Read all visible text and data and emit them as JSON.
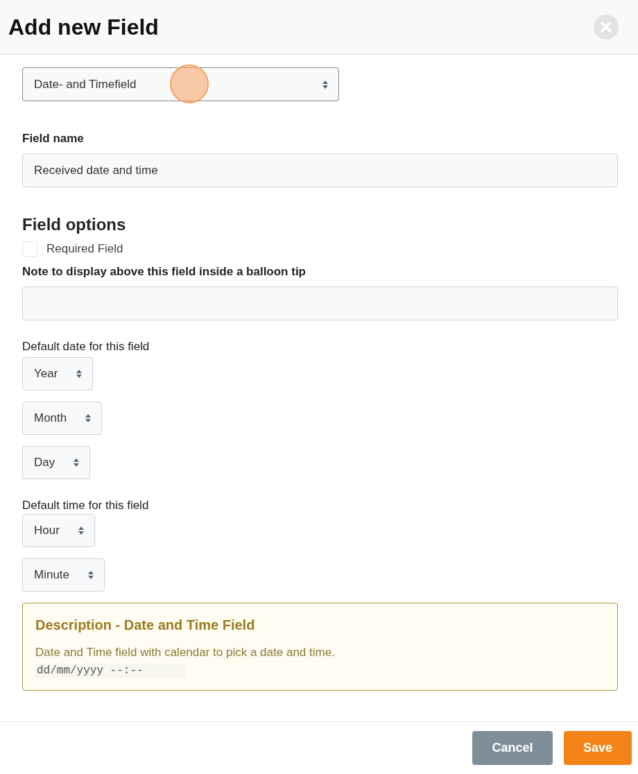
{
  "dialog": {
    "title": "Add new Field"
  },
  "field_type": {
    "value": "Date- and Timefield"
  },
  "field_name": {
    "label": "Field name",
    "value": "Received date and time"
  },
  "options": {
    "heading": "Field options",
    "required": {
      "label": "Required Field",
      "checked": false
    },
    "note": {
      "label": "Note to display above this field inside a balloon tip"
    },
    "date": {
      "label": "Default date for this field",
      "selects": [
        "Year",
        "Month",
        "Day"
      ]
    },
    "time": {
      "label": "Default time for this field",
      "selects": [
        "Hour",
        "Minute"
      ]
    }
  },
  "description": {
    "title": "Description - Date and Time Field",
    "text": "Date and Time field with calendar to pick a date and time.",
    "sample": "dd/mm/yyyy --:--"
  },
  "buttons": [
    {
      "label": "Cancel",
      "kind": "secondary"
    },
    {
      "label": "Save",
      "kind": "primary"
    }
  ]
}
